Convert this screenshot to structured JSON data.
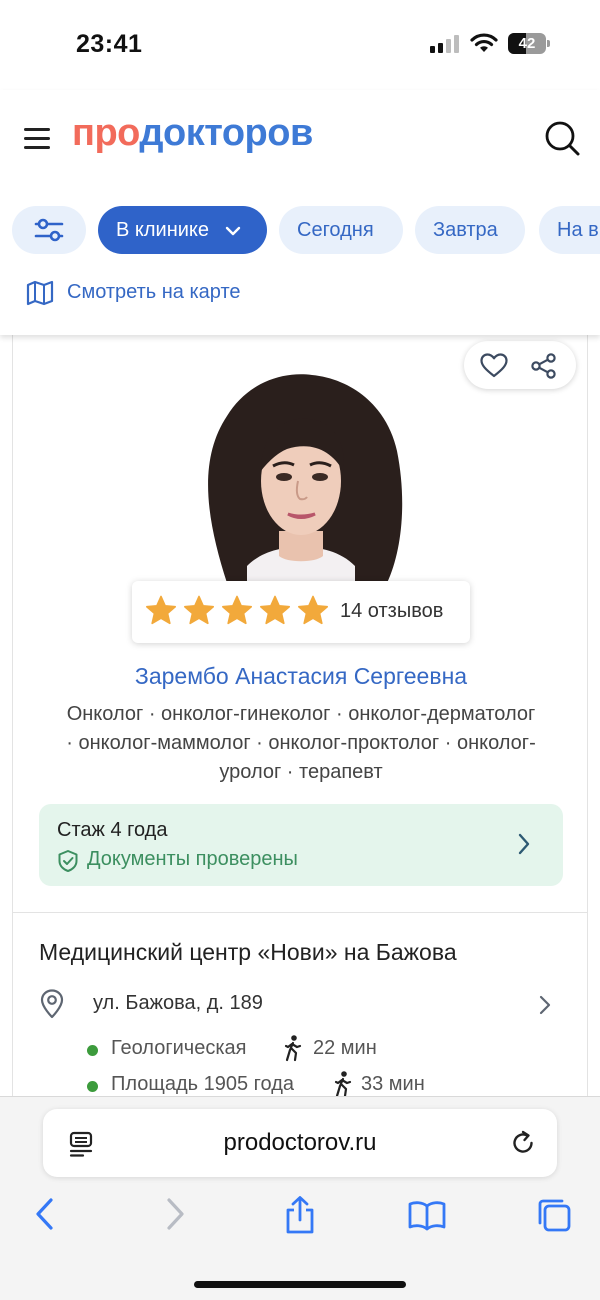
{
  "status": {
    "time": "23:41",
    "battery": "42"
  },
  "header": {
    "logo_part1": "про",
    "logo_part2": "докторов",
    "filters": [
      "В клинике",
      "Сегодня",
      "Завтра",
      "На в"
    ],
    "map_link": "Смотреть на карте"
  },
  "doctor": {
    "reviews": "14 отзывов",
    "stars": 5,
    "name": "Зарембо Анастасия Сергеевна",
    "specialties": "Онколог · онколог-гинеколог · онколог-дерматолог · онколог-маммолог · онколог-проктолог · онколог-уролог · терапевт",
    "experience": "Стаж 4 года",
    "documents": "Документы проверены"
  },
  "clinic": {
    "name": "Медицинский центр «Нови» на Бажова",
    "address": "ул. Бажова, д. 189",
    "metro": [
      {
        "station": "Геологическая",
        "time": "22 мин"
      },
      {
        "station": "Площадь 1905 года",
        "time": "33 мин"
      }
    ]
  },
  "browser": {
    "url": "prodoctorov.ru"
  },
  "colors": {
    "brand_red": "#f26b5b",
    "brand_blue": "#3e7ad6",
    "chip_active": "#2f63c9",
    "star": "#f2a93b",
    "success": "#3c8f60"
  }
}
